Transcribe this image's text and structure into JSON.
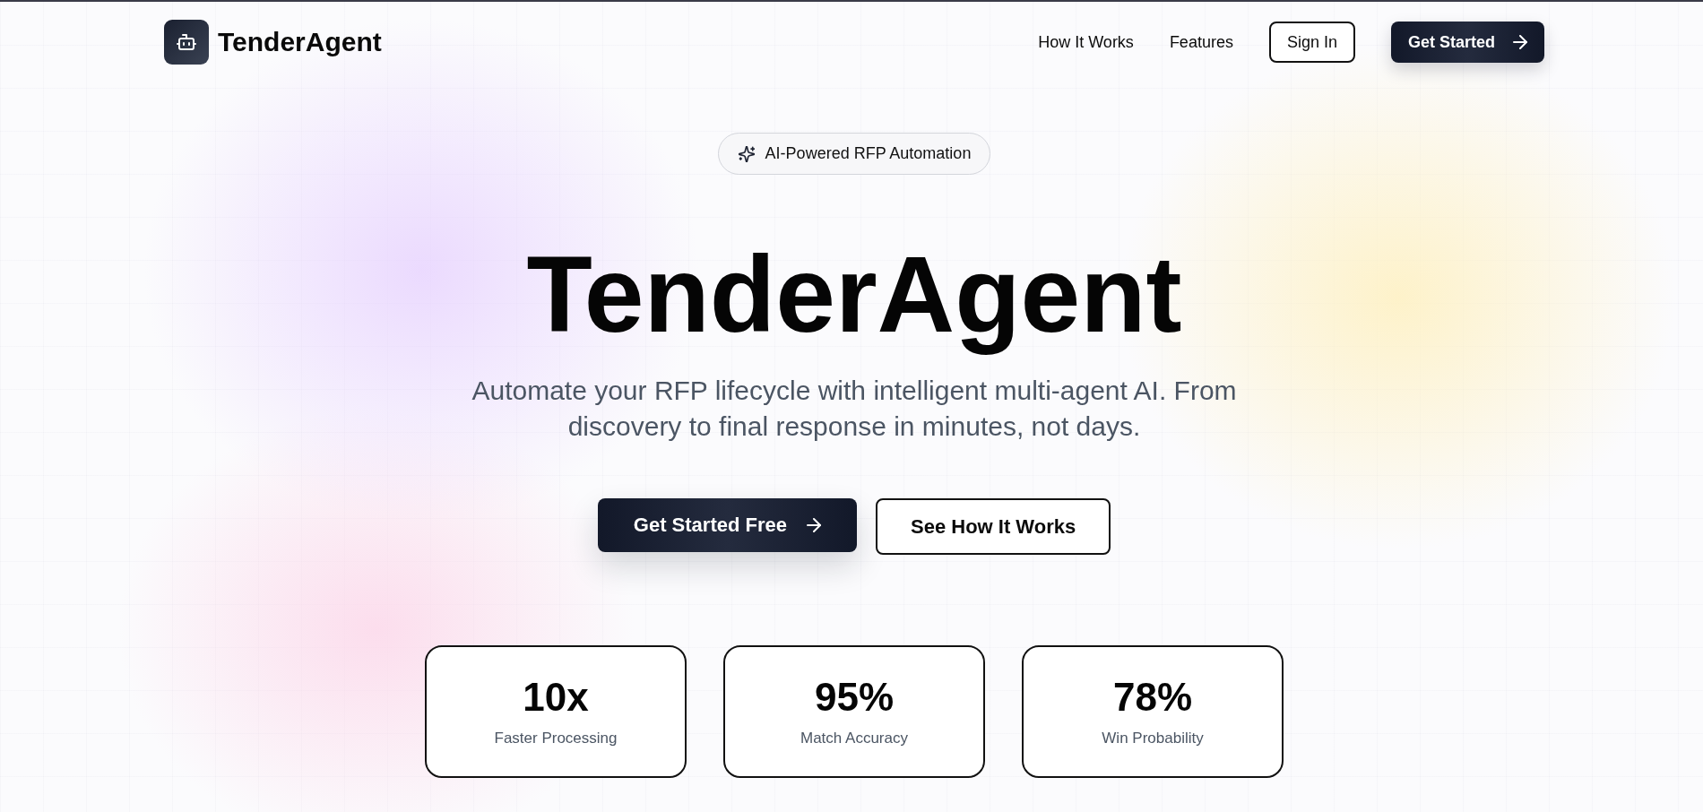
{
  "header": {
    "brand": "TenderAgent",
    "nav_links": [
      "How It Works",
      "Features"
    ],
    "actions": [
      {
        "label": "Sign In",
        "kind": "secondary"
      },
      {
        "label": "Get Started",
        "kind": "primary"
      }
    ]
  },
  "hero": {
    "badge": "AI-Powered RFP Automation",
    "title": "TenderAgent",
    "subtitle": "Automate your RFP lifecycle with intelligent multi-agent AI. From discovery to final response in minutes, not days.",
    "buttons": [
      {
        "label": "Get Started Free",
        "kind": "primary"
      },
      {
        "label": "See How It Works",
        "kind": "secondary"
      }
    ]
  },
  "stats": [
    {
      "value": "10x",
      "label": "Faster Processing"
    },
    {
      "value": "95%",
      "label": "Match Accuracy"
    },
    {
      "value": "78%",
      "label": "Win Probability"
    }
  ]
}
